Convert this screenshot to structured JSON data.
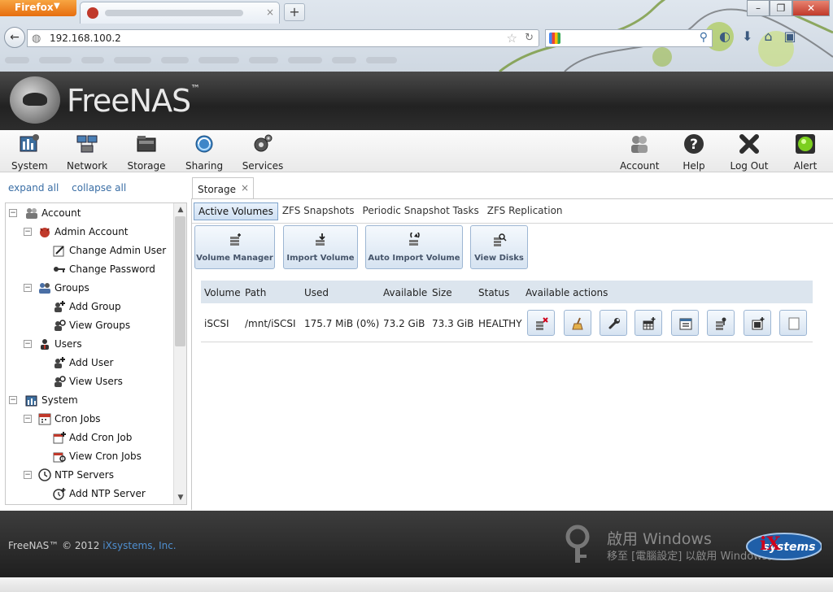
{
  "browser": {
    "app_button": "Firefox",
    "url": "192.168.100.2",
    "new_tab": "+"
  },
  "header": {
    "logo_text": "FreeNAS",
    "logo_tm": "™"
  },
  "toolbar": {
    "left": [
      {
        "label": "System",
        "icon": "system-icon"
      },
      {
        "label": "Network",
        "icon": "network-icon"
      },
      {
        "label": "Storage",
        "icon": "storage-icon"
      },
      {
        "label": "Sharing",
        "icon": "sharing-icon"
      },
      {
        "label": "Services",
        "icon": "services-icon"
      }
    ],
    "right": [
      {
        "label": "Account",
        "icon": "account-icon"
      },
      {
        "label": "Help",
        "icon": "help-icon"
      },
      {
        "label": "Log Out",
        "icon": "logout-icon"
      },
      {
        "label": "Alert",
        "icon": "alert-icon"
      }
    ]
  },
  "tree": {
    "expand_all": "expand all",
    "collapse_all": "collapse all",
    "items": [
      {
        "label": "Account",
        "level": 0,
        "expander": "−"
      },
      {
        "label": "Admin Account",
        "level": 1,
        "expander": "−"
      },
      {
        "label": "Change Admin User",
        "level": 2
      },
      {
        "label": "Change Password",
        "level": 2
      },
      {
        "label": "Groups",
        "level": 1,
        "expander": "−"
      },
      {
        "label": "Add Group",
        "level": 2
      },
      {
        "label": "View Groups",
        "level": 2
      },
      {
        "label": "Users",
        "level": 1,
        "expander": "−"
      },
      {
        "label": "Add User",
        "level": 2
      },
      {
        "label": "View Users",
        "level": 2
      },
      {
        "label": "System",
        "level": 0,
        "expander": "−"
      },
      {
        "label": "Cron Jobs",
        "level": 1,
        "expander": "−"
      },
      {
        "label": "Add Cron Job",
        "level": 2
      },
      {
        "label": "View Cron Jobs",
        "level": 2
      },
      {
        "label": "NTP Servers",
        "level": 1,
        "expander": "−"
      },
      {
        "label": "Add NTP Server",
        "level": 2
      }
    ]
  },
  "content": {
    "tab_label": "Storage",
    "tab_close": "×",
    "subtabs": [
      "Active Volumes",
      "ZFS Snapshots",
      "Periodic Snapshot Tasks",
      "ZFS Replication"
    ],
    "action_buttons": [
      "Volume Manager",
      "Import Volume",
      "Auto Import Volume",
      "View Disks"
    ],
    "table": {
      "columns": [
        "Volume",
        "Path",
        "Used",
        "Available",
        "Size",
        "Status",
        "Available actions"
      ],
      "rows": [
        {
          "volume": "iSCSI",
          "path": "/mnt/iSCSI",
          "used": "175.7 MiB (0%)",
          "available": "73.2 GiB",
          "size": "73.3 GiB",
          "status": "HEALTHY"
        }
      ]
    }
  },
  "footer": {
    "copyright": "FreeNAS™ © 2012 ",
    "company": "iXsystems, Inc.",
    "watermark_line1": "啟用 Windows",
    "watermark_line2": "移至 [電腦設定] 以啟用 Windows。",
    "ix_logo_text": "systems"
  },
  "colors": {
    "link": "#3a6ea5",
    "accent_button": "#d6e3f1",
    "header_bg": "#222222",
    "status_healthy": "#222222"
  }
}
